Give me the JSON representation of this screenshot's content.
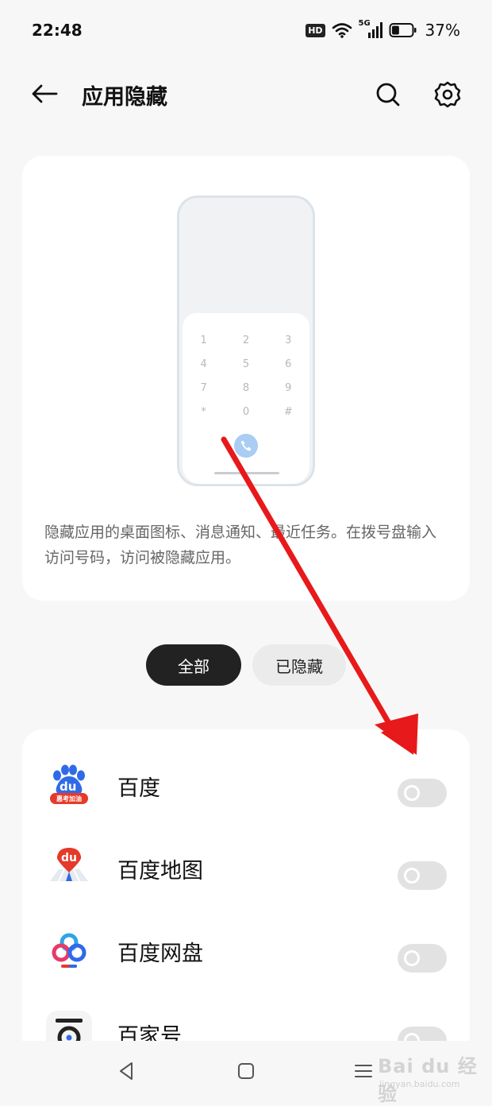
{
  "status_bar": {
    "time": "22:48",
    "hd_badge": "HD",
    "network_label": "5G",
    "battery_percent": "37%",
    "battery_level": 0.37,
    "icons": [
      "wifi-icon",
      "cellular-signal-icon",
      "battery-icon"
    ]
  },
  "header": {
    "title": "应用隐藏",
    "back_icon": "back-arrow-icon",
    "search_icon": "search-icon",
    "settings_icon": "gear-icon"
  },
  "intro": {
    "dialpad_keys": [
      "1",
      "2",
      "3",
      "4",
      "5",
      "6",
      "7",
      "8",
      "9",
      "*",
      "0",
      "#"
    ],
    "call_icon": "phone-icon",
    "description": "隐藏应用的桌面图标、消息通知、最近任务。在拨号盘输入访问号码，访问被隐藏应用。"
  },
  "tabs": [
    {
      "label": "全部",
      "active": true
    },
    {
      "label": "已隐藏",
      "active": false
    }
  ],
  "apps": [
    {
      "name": "百度",
      "icon": "baidu-app-icon",
      "icon_text": "du",
      "icon_badge": "惠考加油",
      "hidden": false
    },
    {
      "name": "百度地图",
      "icon": "baidu-map-icon",
      "icon_text": "du",
      "hidden": false
    },
    {
      "name": "百度网盘",
      "icon": "baidu-netdisk-icon",
      "hidden": false
    },
    {
      "name": "百家号",
      "icon": "baijiahao-icon",
      "hidden": false
    }
  ],
  "annotation": {
    "arrow_color": "#e8191a",
    "icon": "red-arrow-annotation"
  },
  "nav_bar": {
    "icons": [
      "nav-back-icon",
      "nav-home-icon",
      "nav-menu-icon"
    ]
  },
  "watermark": {
    "main": "Bai du 经验",
    "sub": "jingyan.baidu.com"
  },
  "colors": {
    "background": "#f7f7f7",
    "card": "#ffffff",
    "tab_active_bg": "#222222",
    "tab_inactive_bg": "#ebebeb",
    "toggle_off": "#e2e2e2",
    "baidu_blue": "#2f6be8",
    "baidu_red": "#e53a2a"
  }
}
